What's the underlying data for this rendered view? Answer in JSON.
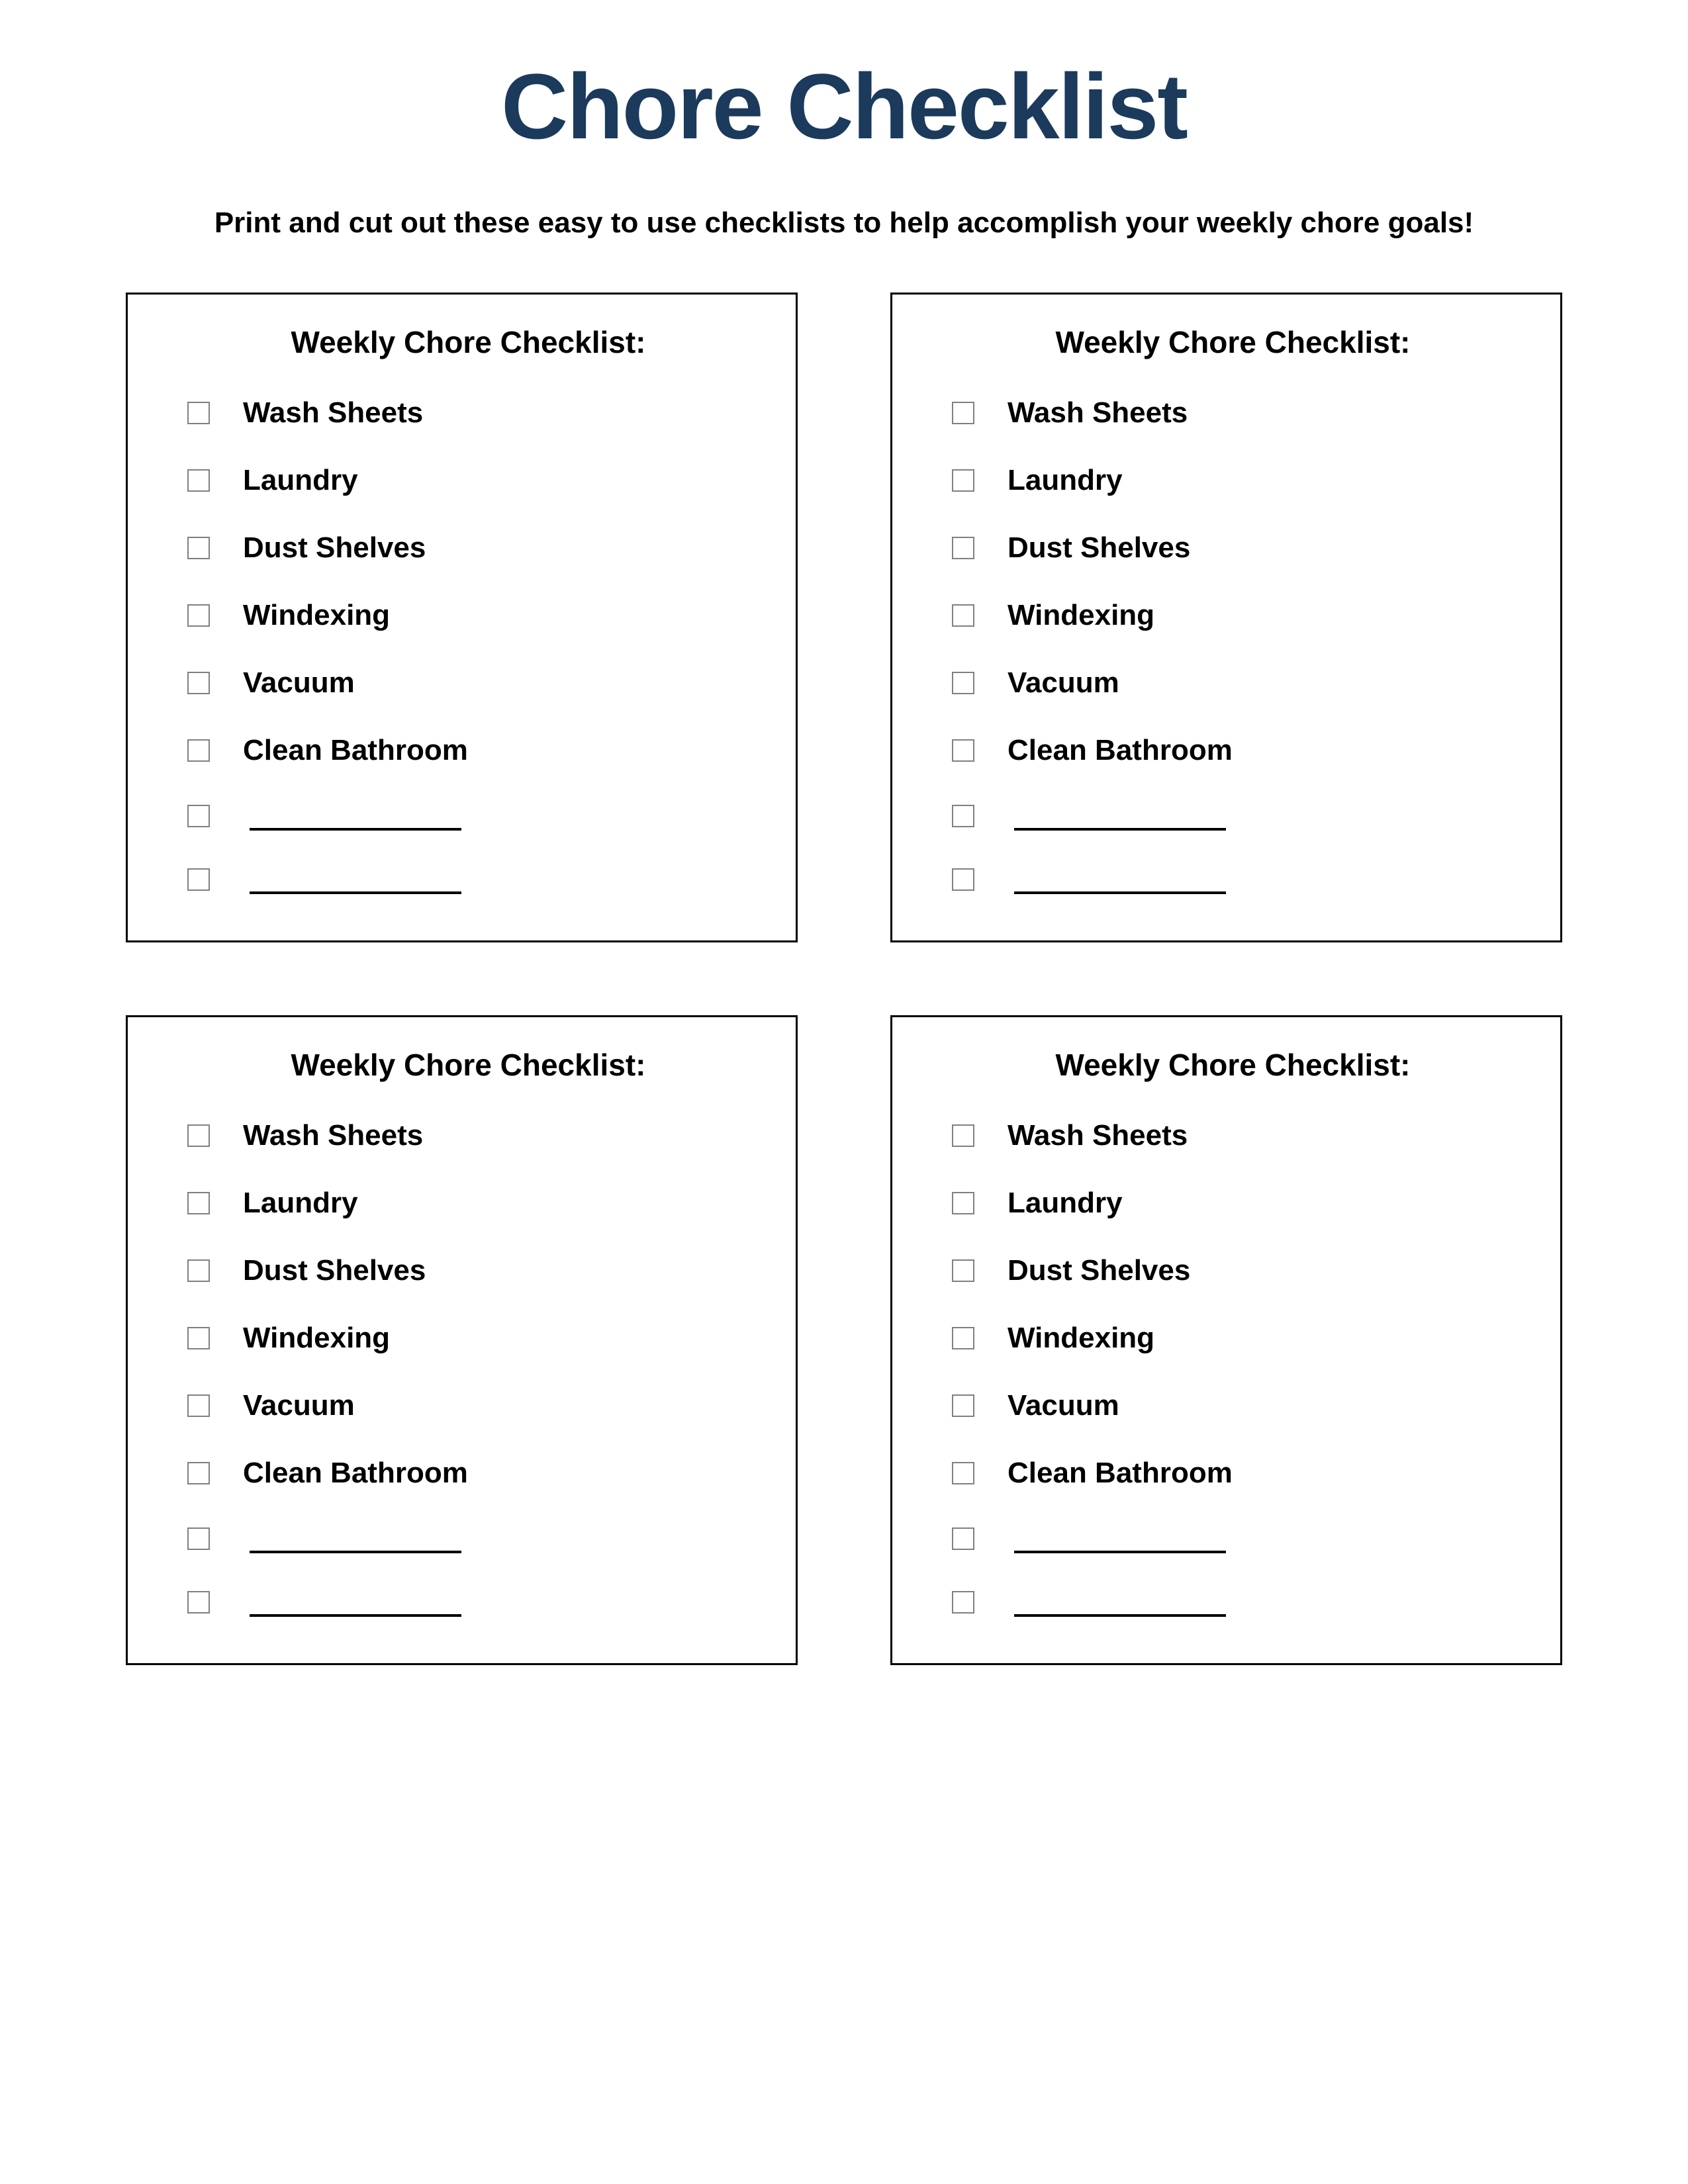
{
  "title": "Chore Checklist",
  "subtitle": "Print and cut out these easy to use checklists to help accomplish your weekly chore goals!",
  "card_title": "Weekly Chore Checklist:",
  "items": [
    "Wash Sheets",
    "Laundry",
    "Dust Shelves",
    "Windexing",
    "Vacuum",
    "Clean Bathroom"
  ],
  "blank_count": 2,
  "card_count": 4
}
